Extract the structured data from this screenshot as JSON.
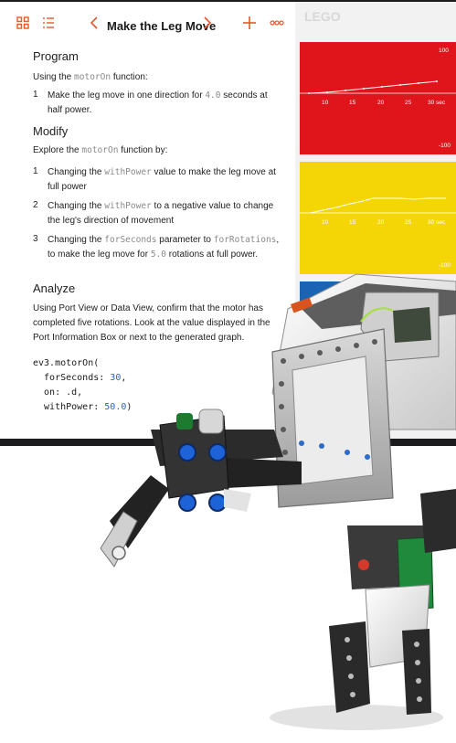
{
  "toolbar": {
    "title": "Make the Leg Move",
    "icons": [
      "grid-icon",
      "list-icon",
      "chevron-left-icon",
      "chevron-right-icon",
      "plus-icon",
      "more-icon"
    ],
    "accent": "#e8562d"
  },
  "sections": {
    "program": {
      "heading": "Program",
      "intro_pre": "Using the ",
      "intro_code": "motorOn",
      "intro_post": " function:",
      "items": [
        {
          "num": "1",
          "pre": "Make the leg move in one direction for ",
          "code": "4.0",
          "post": " seconds at half power."
        }
      ]
    },
    "modify": {
      "heading": "Modify",
      "intro_pre": "Explore the ",
      "intro_code": "motorOn",
      "intro_post": " function by:",
      "items": [
        {
          "num": "1",
          "pre": "Changing the ",
          "code": "withPower",
          "post": " value to make the leg move at full power"
        },
        {
          "num": "2",
          "pre": "Changing the ",
          "code": "withPower",
          "post": " to a negative value to change the leg's direction of movement"
        },
        {
          "num": "3",
          "pre": "Changing the ",
          "code": "forSeconds",
          "mid": " parameter to ",
          "code2": "forRotations",
          "mid2": ", to make the leg move for ",
          "code3": "5.0",
          "post": " rotations at full power."
        }
      ]
    },
    "analyze": {
      "heading": "Analyze",
      "text": "Using Port View or Data View, confirm that the motor has completed five rotations. Look at the value displayed in the Port Information Box or next to the generated graph."
    }
  },
  "code": {
    "line1": "ev3.motorOn(",
    "line2_key": "  forSeconds: ",
    "line2_val": "30",
    "line2_end": ",",
    "line3": "  on: .d,",
    "line4_key": "  withPower: ",
    "line4_val": "50.0",
    "line4_end": ")"
  },
  "panel": {
    "brand": "LEGO",
    "graph_ticks": [
      "10",
      "15",
      "20",
      "25",
      "30 sec"
    ],
    "y_top": "100",
    "y_bottom": "-100",
    "colors": {
      "red": "#e0151c",
      "yellow": "#f4d607",
      "blue": "#1b63b3"
    }
  }
}
